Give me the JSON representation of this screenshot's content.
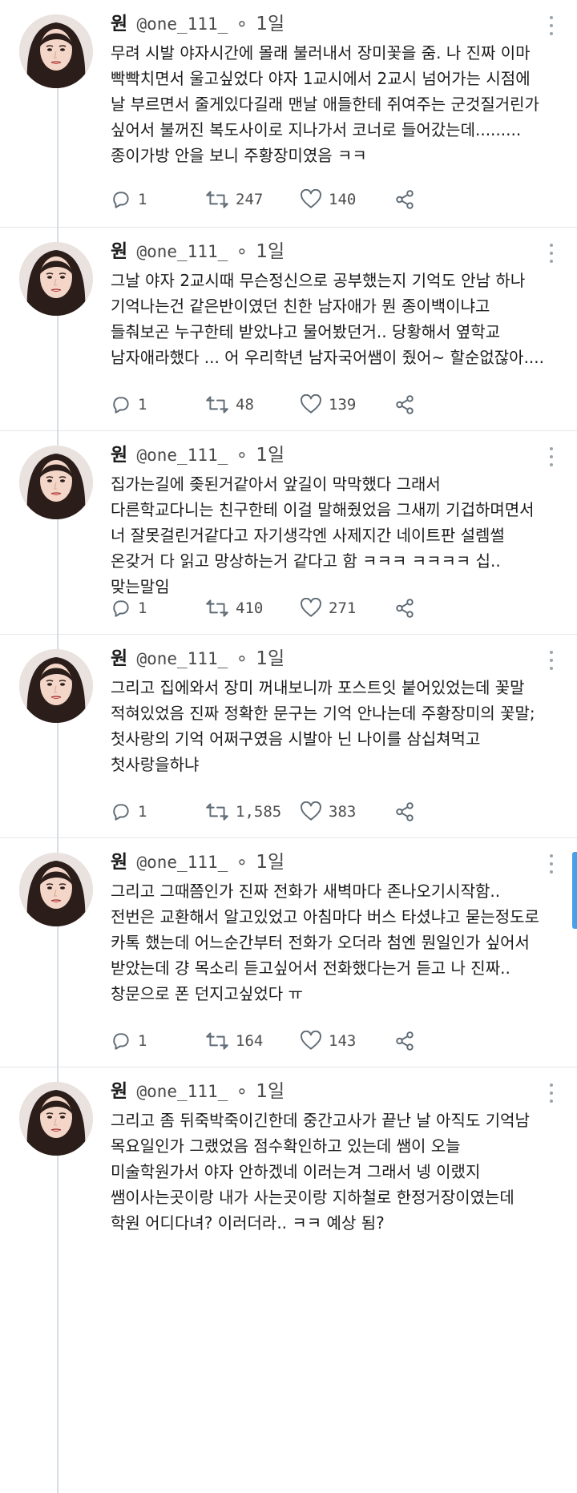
{
  "tweets": [
    {
      "name": "원",
      "handle": "@one_111_",
      "dot": "∘",
      "time": "1일",
      "text": "무려 시발 야자시간에 몰래 불러내서 장미꽃을 줌. 나 진짜 이마 빡빡치면서 울고싶었다 야자 1교시에서 2교시 넘어가는 시점에 날 부르면서 줄게있다길래 맨날 애들한테 쥐여주는 군것질거린가 싶어서 불꺼진 복도사이로 지나가서 코너로 들어갔는데.........\n종이가방 안을 보니 주황장미였음 ㅋㅋ",
      "replies": "1",
      "retweets": "247",
      "likes": "140"
    },
    {
      "name": "원",
      "handle": "@one_111_",
      "dot": "∘",
      "time": "1일",
      "text": "그날 야자 2교시때 무슨정신으로 공부했는지 기억도 안남 하나 기억나는건 같은반이였던 친한 남자애가 뭔 종이백이냐고 들춰보곤 누구한테 받았냐고 물어봤던거.. 당황해서 옆학교 남자애라했다 ... 어 우리학년 남자국어쌤이 줬어~ 할순없잖아....",
      "replies": "1",
      "retweets": "48",
      "likes": "139"
    },
    {
      "name": "원",
      "handle": "@one_111_",
      "dot": "∘",
      "time": "1일",
      "text": "집가는길에 좆된거같아서 앞길이 막막했다 그래서 다른학교다니는 친구한테 이걸 말해줬었음 그새끼 기겁하며면서 너 잘못걸린거같다고 자기생각엔 사제지간 네이트판 설렘썰 온갖거 다 읽고 망상하는거 같다고 함 ㅋㅋㅋ ㅋㅋㅋㅋ 십.. 맞는말임",
      "replies": "1",
      "retweets": "410",
      "likes": "271"
    },
    {
      "name": "원",
      "handle": "@one_111_",
      "dot": "∘",
      "time": "1일",
      "text": "그리고 집에와서 장미 꺼내보니까 포스트잇 붙어있었는데 꽃말 적혀있었음 진짜 정확한 문구는 기억 안나는데 주황장미의 꽃말; 첫사랑의 기억 어쩌구였음 시발아 닌 나이를 삼십쳐먹고 첫사랑을하냐",
      "replies": "1",
      "retweets": "1,585",
      "likes": "383"
    },
    {
      "name": "원",
      "handle": "@one_111_",
      "dot": "∘",
      "time": "1일",
      "text": "그리고 그때쯤인가 진짜 전화가 새벽마다 존나오기시작함.. 전번은 교환해서 알고있었고 아침마다 버스 타셨냐고 묻는정도로 카톡 했는데 어느순간부터 전화가 오더라 첨엔 뭔일인가 싶어서 받았는데 걍 목소리 듣고싶어서 전화했다는거 듣고 나 진짜.. 창문으로 폰 던지고싶었다 ㅠ",
      "replies": "1",
      "retweets": "164",
      "likes": "143"
    },
    {
      "name": "원",
      "handle": "@one_111_",
      "dot": "∘",
      "time": "1일",
      "text": "그리고 좀 뒤죽박죽이긴한데 중간고사가 끝난 날 아직도 기억남 목요일인가 그랬었음 점수확인하고 있는데 쌤이 오늘 미술학원가서 야자 안하겠네 이러는겨 그래서 넹 이랬지 쌤이사는곳이랑 내가 사는곳이랑 지하철로 한정거장이였는데 학원 어디다녀? 이러더라.. ㅋㅋ 예상 됨?",
      "replies": "",
      "retweets": "",
      "likes": ""
    }
  ]
}
